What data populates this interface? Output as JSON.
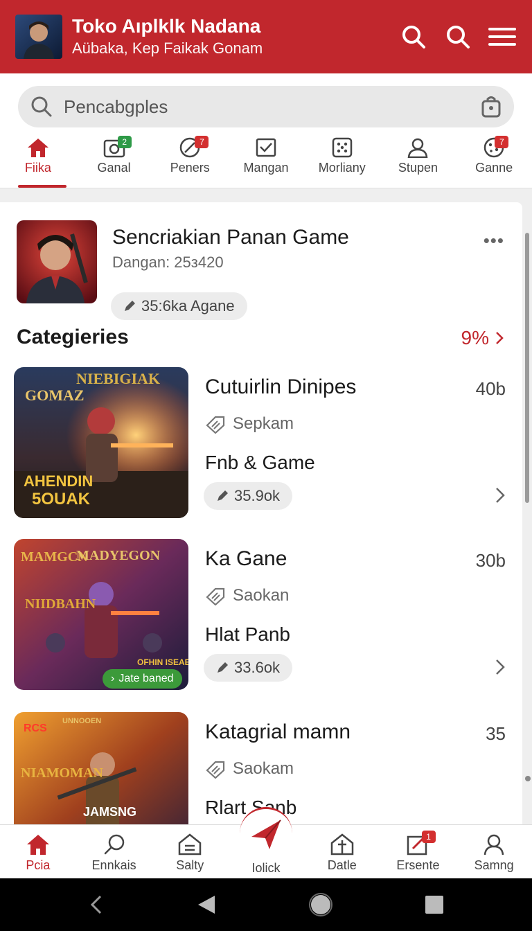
{
  "header": {
    "title": "Toko Aıplklk Nadana",
    "subtitle": "Aübaka, Kep Faikak Gonam",
    "actions": [
      "search-icon",
      "search-icon",
      "menu-icon"
    ]
  },
  "search": {
    "placeholder": "Pencabgples"
  },
  "tabs": [
    {
      "label": "Fiika",
      "icon": "home-icon",
      "active": true
    },
    {
      "label": "Ganal",
      "icon": "camera-icon",
      "badge": "2"
    },
    {
      "label": "Peners",
      "icon": "edit-icon",
      "badge": "7"
    },
    {
      "label": "Mangan",
      "icon": "check-box-icon"
    },
    {
      "label": "Morliany",
      "icon": "dice-icon"
    },
    {
      "label": "Stupen",
      "icon": "user-icon"
    },
    {
      "label": "Ganne",
      "icon": "cookie-icon",
      "badge": "7"
    }
  ],
  "featured": {
    "title": "Sencriakian Panan Game",
    "subtitle": "Dangan: 25з420",
    "pill": "35:6ka Agane"
  },
  "section": {
    "title": "Categieries",
    "link": "9%"
  },
  "games": [
    {
      "title": "Cutuirlin Dinipes",
      "count": "40b",
      "tag": "Sepkam",
      "subtitle": "Fnb & Game",
      "pill": "35.9ok"
    },
    {
      "title": "Ka Gane",
      "count": "30b",
      "tag": "Saokan",
      "subtitle": "Hlat Panb",
      "pill": "33.6ok",
      "thumb_badge": "Jate baned"
    },
    {
      "title": "Katagrial mamn",
      "count": "35",
      "tag": "Saokam",
      "subtitle": "Rlart Sanb",
      "pill": ""
    }
  ],
  "bottom_nav": [
    {
      "label": "Pcia",
      "icon": "home-icon",
      "active": true
    },
    {
      "label": "Ennkais",
      "icon": "search-icon"
    },
    {
      "label": "Salty",
      "icon": "tag-icon"
    },
    {
      "label": "Iolick",
      "icon": "send-icon"
    },
    {
      "label": "Datle",
      "icon": "house-outline-icon"
    },
    {
      "label": "Ersente",
      "icon": "edit-box-icon",
      "badge": "1"
    },
    {
      "label": "Samng",
      "icon": "user-icon"
    }
  ],
  "colors": {
    "brand": "#c1272d",
    "badge_green": "#2e9a47"
  }
}
